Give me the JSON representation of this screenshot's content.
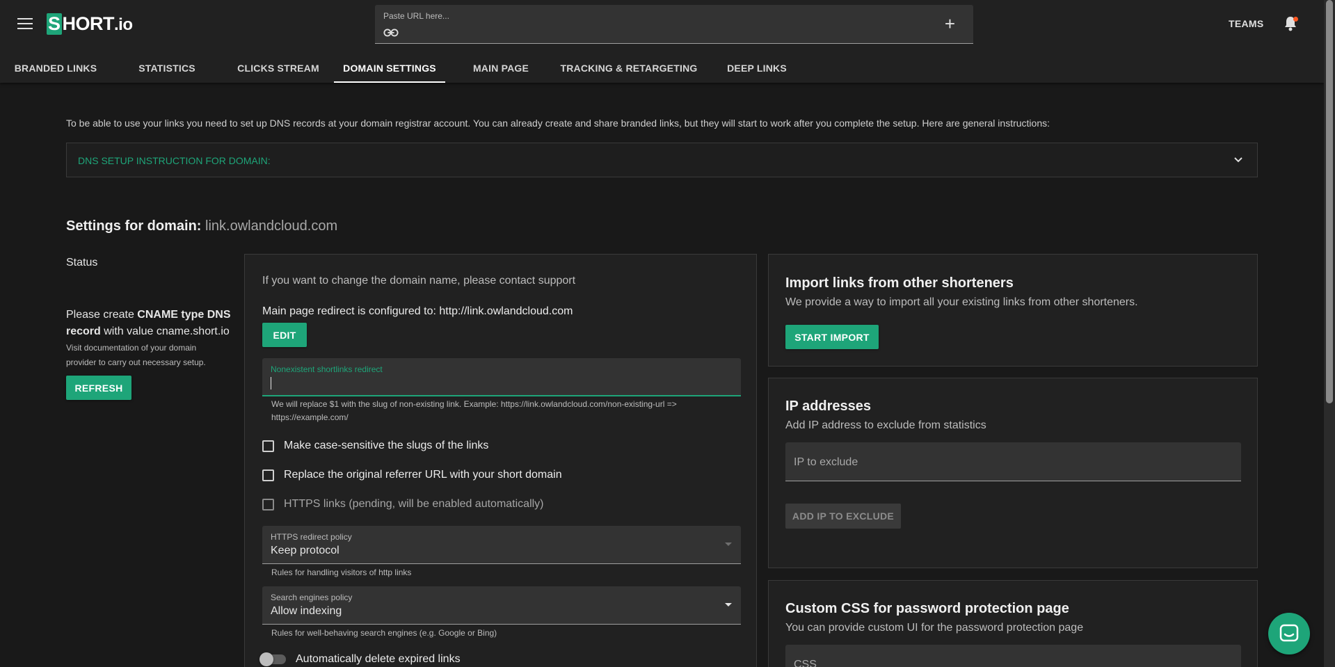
{
  "header": {
    "logo_mark": "S",
    "logo_text": "HORT",
    "logo_suffix": ".io",
    "url_placeholder": "Paste URL here...",
    "teams_label": "TEAMS",
    "notification_badge_color": "#ff5722"
  },
  "tabs": [
    {
      "label": "BRANDED LINKS",
      "active": false
    },
    {
      "label": "STATISTICS",
      "active": false
    },
    {
      "label": "CLICKS STREAM",
      "active": false
    },
    {
      "label": "DOMAIN SETTINGS",
      "active": true
    },
    {
      "label": "MAIN PAGE",
      "active": false
    },
    {
      "label": "TRACKING & RETARGETING",
      "active": false
    },
    {
      "label": "DEEP LINKS",
      "active": false
    }
  ],
  "intro_text": "To be able to use your links you need to set up DNS records at your domain registrar account. You can already create and share branded links, but they will start to work after you complete the setup. Here are general instructions:",
  "dns_panel": {
    "label": "DNS SETUP INSTRUCTION FOR DOMAIN:"
  },
  "settings": {
    "title_prefix": "Settings for domain:",
    "domain": "link.owlandcloud.com"
  },
  "status": {
    "label": "Status",
    "cname_part1": "Please create ",
    "cname_bold1": "CNAME type DNS record",
    "cname_part2": " with value cname.short.io",
    "cname_sub": "Visit documentation of your domain provider to carry out necessary setup.",
    "refresh_label": "REFRESH"
  },
  "domain_card": {
    "change_note": "If you want to change the domain name, please contact support",
    "redirect_text": "Main page redirect is configured to: http://link.owlandcloud.com",
    "edit_label": "EDIT",
    "nonexistent_label": "Nonexistent shortlinks redirect",
    "nonexistent_helper": "We will replace $1 with the slug of non-existing link. Example: https://link.owlandcloud.com/non-existing-url => https://example.com/",
    "checkbox_case": "Make case-sensitive the slugs of the links",
    "checkbox_referrer": "Replace the original referrer URL with your short domain",
    "checkbox_https": "HTTPS links (pending, will be enabled automatically)",
    "https_policy_label": "HTTPS redirect policy",
    "https_policy_value": "Keep protocol",
    "https_policy_helper": "Rules for handling visitors of http links",
    "search_policy_label": "Search engines policy",
    "search_policy_value": "Allow indexing",
    "search_policy_helper": "Rules for well-behaving search engines (e.g. Google or Bing)",
    "auto_delete_label": "Automatically delete expired links"
  },
  "import_card": {
    "title": "Import links from other shorteners",
    "subtitle": "We provide a way to import all your existing links from other shorteners.",
    "button": "START IMPORT"
  },
  "ip_card": {
    "title": "IP addresses",
    "subtitle": "Add IP address to exclude from statistics",
    "input_placeholder": "IP to exclude",
    "button": "ADD IP TO EXCLUDE"
  },
  "css_card": {
    "title": "Custom CSS for password protection page",
    "subtitle": "You can provide custom UI for the password protection page",
    "input_placeholder": "CSS"
  },
  "colors": {
    "accent": "#1ea579",
    "background": "#191919",
    "surface": "#212121"
  }
}
